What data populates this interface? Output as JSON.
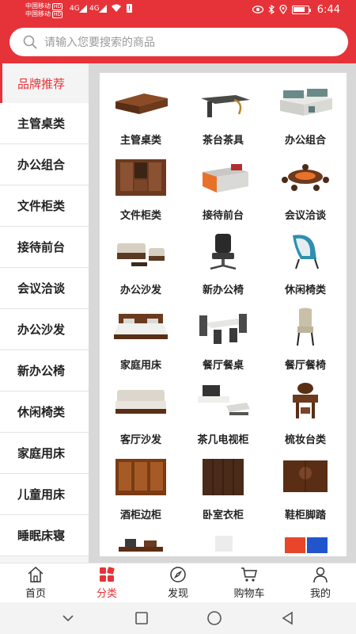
{
  "status_bar": {
    "carrier1": "中国移动",
    "carrier2": "中国移动",
    "hd": "HD",
    "net1": "4G",
    "net2": "4G",
    "time": "6:44"
  },
  "search": {
    "placeholder": "请输入您要搜索的商品"
  },
  "categories": [
    {
      "label": "品牌推荐",
      "active": true
    },
    {
      "label": "主管桌类"
    },
    {
      "label": "办公组合"
    },
    {
      "label": "文件柜类"
    },
    {
      "label": "接待前台"
    },
    {
      "label": "会议洽谈"
    },
    {
      "label": "办公沙发"
    },
    {
      "label": "新办公椅"
    },
    {
      "label": "休闲椅类"
    },
    {
      "label": "家庭用床"
    },
    {
      "label": "儿童用床"
    },
    {
      "label": "睡眠床寝"
    }
  ],
  "products": [
    {
      "label": "主管桌类",
      "icon": "desk-icon"
    },
    {
      "label": "茶台茶具",
      "icon": "tea-table-icon"
    },
    {
      "label": "办公组合",
      "icon": "workstation-icon"
    },
    {
      "label": "文件柜类",
      "icon": "file-cabinet-icon"
    },
    {
      "label": "接待前台",
      "icon": "reception-desk-icon"
    },
    {
      "label": "会议洽谈",
      "icon": "meeting-table-icon"
    },
    {
      "label": "办公沙发",
      "icon": "office-sofa-icon"
    },
    {
      "label": "新办公椅",
      "icon": "office-chair-icon"
    },
    {
      "label": "休闲椅类",
      "icon": "lounge-chair-icon"
    },
    {
      "label": "家庭用床",
      "icon": "bed-icon"
    },
    {
      "label": "餐厅餐桌",
      "icon": "dining-table-icon"
    },
    {
      "label": "餐厅餐椅",
      "icon": "dining-chair-icon"
    },
    {
      "label": "客厅沙发",
      "icon": "sofa-icon"
    },
    {
      "label": "茶几电视柜",
      "icon": "tv-cabinet-icon"
    },
    {
      "label": "梳妆台类",
      "icon": "dresser-icon"
    },
    {
      "label": "酒柜边柜",
      "icon": "wine-cabinet-icon"
    },
    {
      "label": "卧室衣柜",
      "icon": "wardrobe-icon"
    },
    {
      "label": "鞋柜脚踏",
      "icon": "shoe-cabinet-icon"
    },
    {
      "label": "",
      "icon": "side-cabinet-icon"
    },
    {
      "label": "",
      "icon": "white-panel-icon"
    },
    {
      "label": "",
      "icon": "locker-icon"
    }
  ],
  "tabs": [
    {
      "label": "首页",
      "icon": "home-icon"
    },
    {
      "label": "分类",
      "icon": "category-icon",
      "active": true
    },
    {
      "label": "发现",
      "icon": "compass-icon"
    },
    {
      "label": "购物车",
      "icon": "cart-icon"
    },
    {
      "label": "我的",
      "icon": "user-icon"
    }
  ],
  "colors": {
    "accent": "#e63339",
    "panel_bg": "#d8d8d8",
    "wood": "#6b3a1f"
  }
}
